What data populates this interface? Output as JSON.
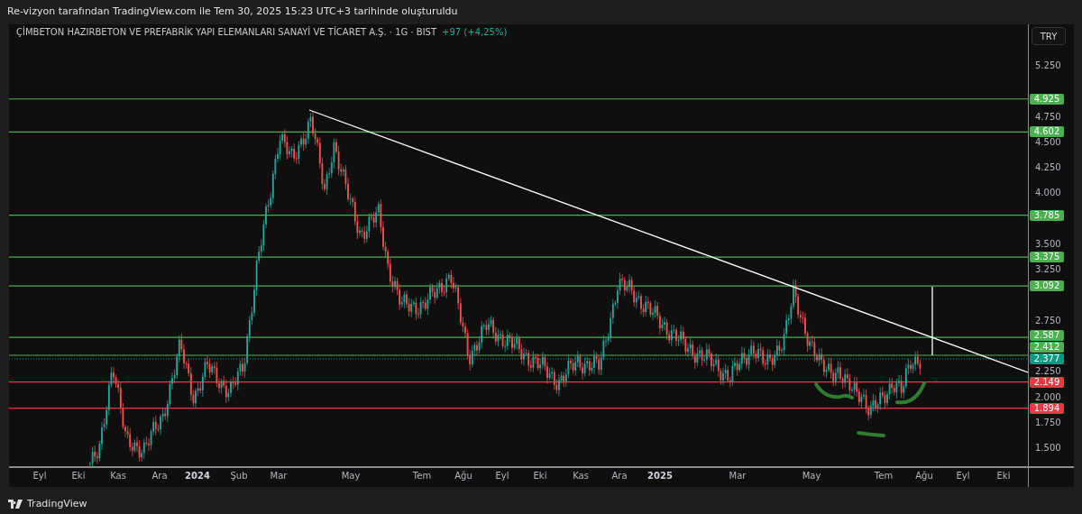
{
  "header": {
    "caption": "Re-vizyon tarafından TradingView.com ile Tem 30, 2025 15:23 UTC+3 tarihinde oluşturuldu"
  },
  "legend": {
    "symbol": "ÇİMBETON HAZIRBETON VE PREFABRİK YAPI ELEMANLARI SANAYİ VE TİCARET A.Ş. · 1G · BIST",
    "change": "+97 (+4,25%)"
  },
  "currency_button": "TRY",
  "price_axis": [
    "5.250",
    "4.750",
    "4.500",
    "4.250",
    "4.000",
    "3.500",
    "3.250",
    "2.750",
    "2.250",
    "2.000",
    "1.750",
    "1.500"
  ],
  "price_lines": [
    {
      "label": "4.925",
      "kind": "line",
      "color": "#4caf50"
    },
    {
      "label": "4.602",
      "kind": "line",
      "color": "#4caf50"
    },
    {
      "label": "3.785",
      "kind": "line",
      "color": "#4caf50"
    },
    {
      "label": "3.375",
      "kind": "line",
      "color": "#4caf50"
    },
    {
      "label": "3.092",
      "kind": "line",
      "color": "#4caf50"
    },
    {
      "label": "2.587",
      "kind": "line",
      "color": "#4caf50"
    },
    {
      "label": "2.412",
      "kind": "line",
      "color": "#4caf50"
    },
    {
      "label": "2.377",
      "kind": "last",
      "color": "#089981"
    },
    {
      "label": "2.149",
      "kind": "line",
      "color": "#f23645"
    },
    {
      "label": "1.894",
      "kind": "line",
      "color": "#f23645"
    }
  ],
  "time_axis": [
    {
      "label": "Eyl",
      "kind": "month"
    },
    {
      "label": "Eki",
      "kind": "month"
    },
    {
      "label": "Kas",
      "kind": "month"
    },
    {
      "label": "Ara",
      "kind": "month"
    },
    {
      "label": "2024",
      "kind": "year"
    },
    {
      "label": "Şub",
      "kind": "month"
    },
    {
      "label": "Mar",
      "kind": "month"
    },
    {
      "label": "May",
      "kind": "month"
    },
    {
      "label": "Tem",
      "kind": "month"
    },
    {
      "label": "Ağu",
      "kind": "month"
    },
    {
      "label": "Eyl",
      "kind": "month"
    },
    {
      "label": "Eki",
      "kind": "month"
    },
    {
      "label": "Kas",
      "kind": "month"
    },
    {
      "label": "Ara",
      "kind": "month"
    },
    {
      "label": "2025",
      "kind": "year"
    },
    {
      "label": "Mar",
      "kind": "month"
    },
    {
      "label": "May",
      "kind": "month"
    },
    {
      "label": "Tem",
      "kind": "month"
    },
    {
      "label": "Ağu",
      "kind": "month"
    },
    {
      "label": "Eyl",
      "kind": "month"
    },
    {
      "label": "Eki",
      "kind": "month"
    }
  ],
  "footer": {
    "brand": "TradingView"
  }
}
